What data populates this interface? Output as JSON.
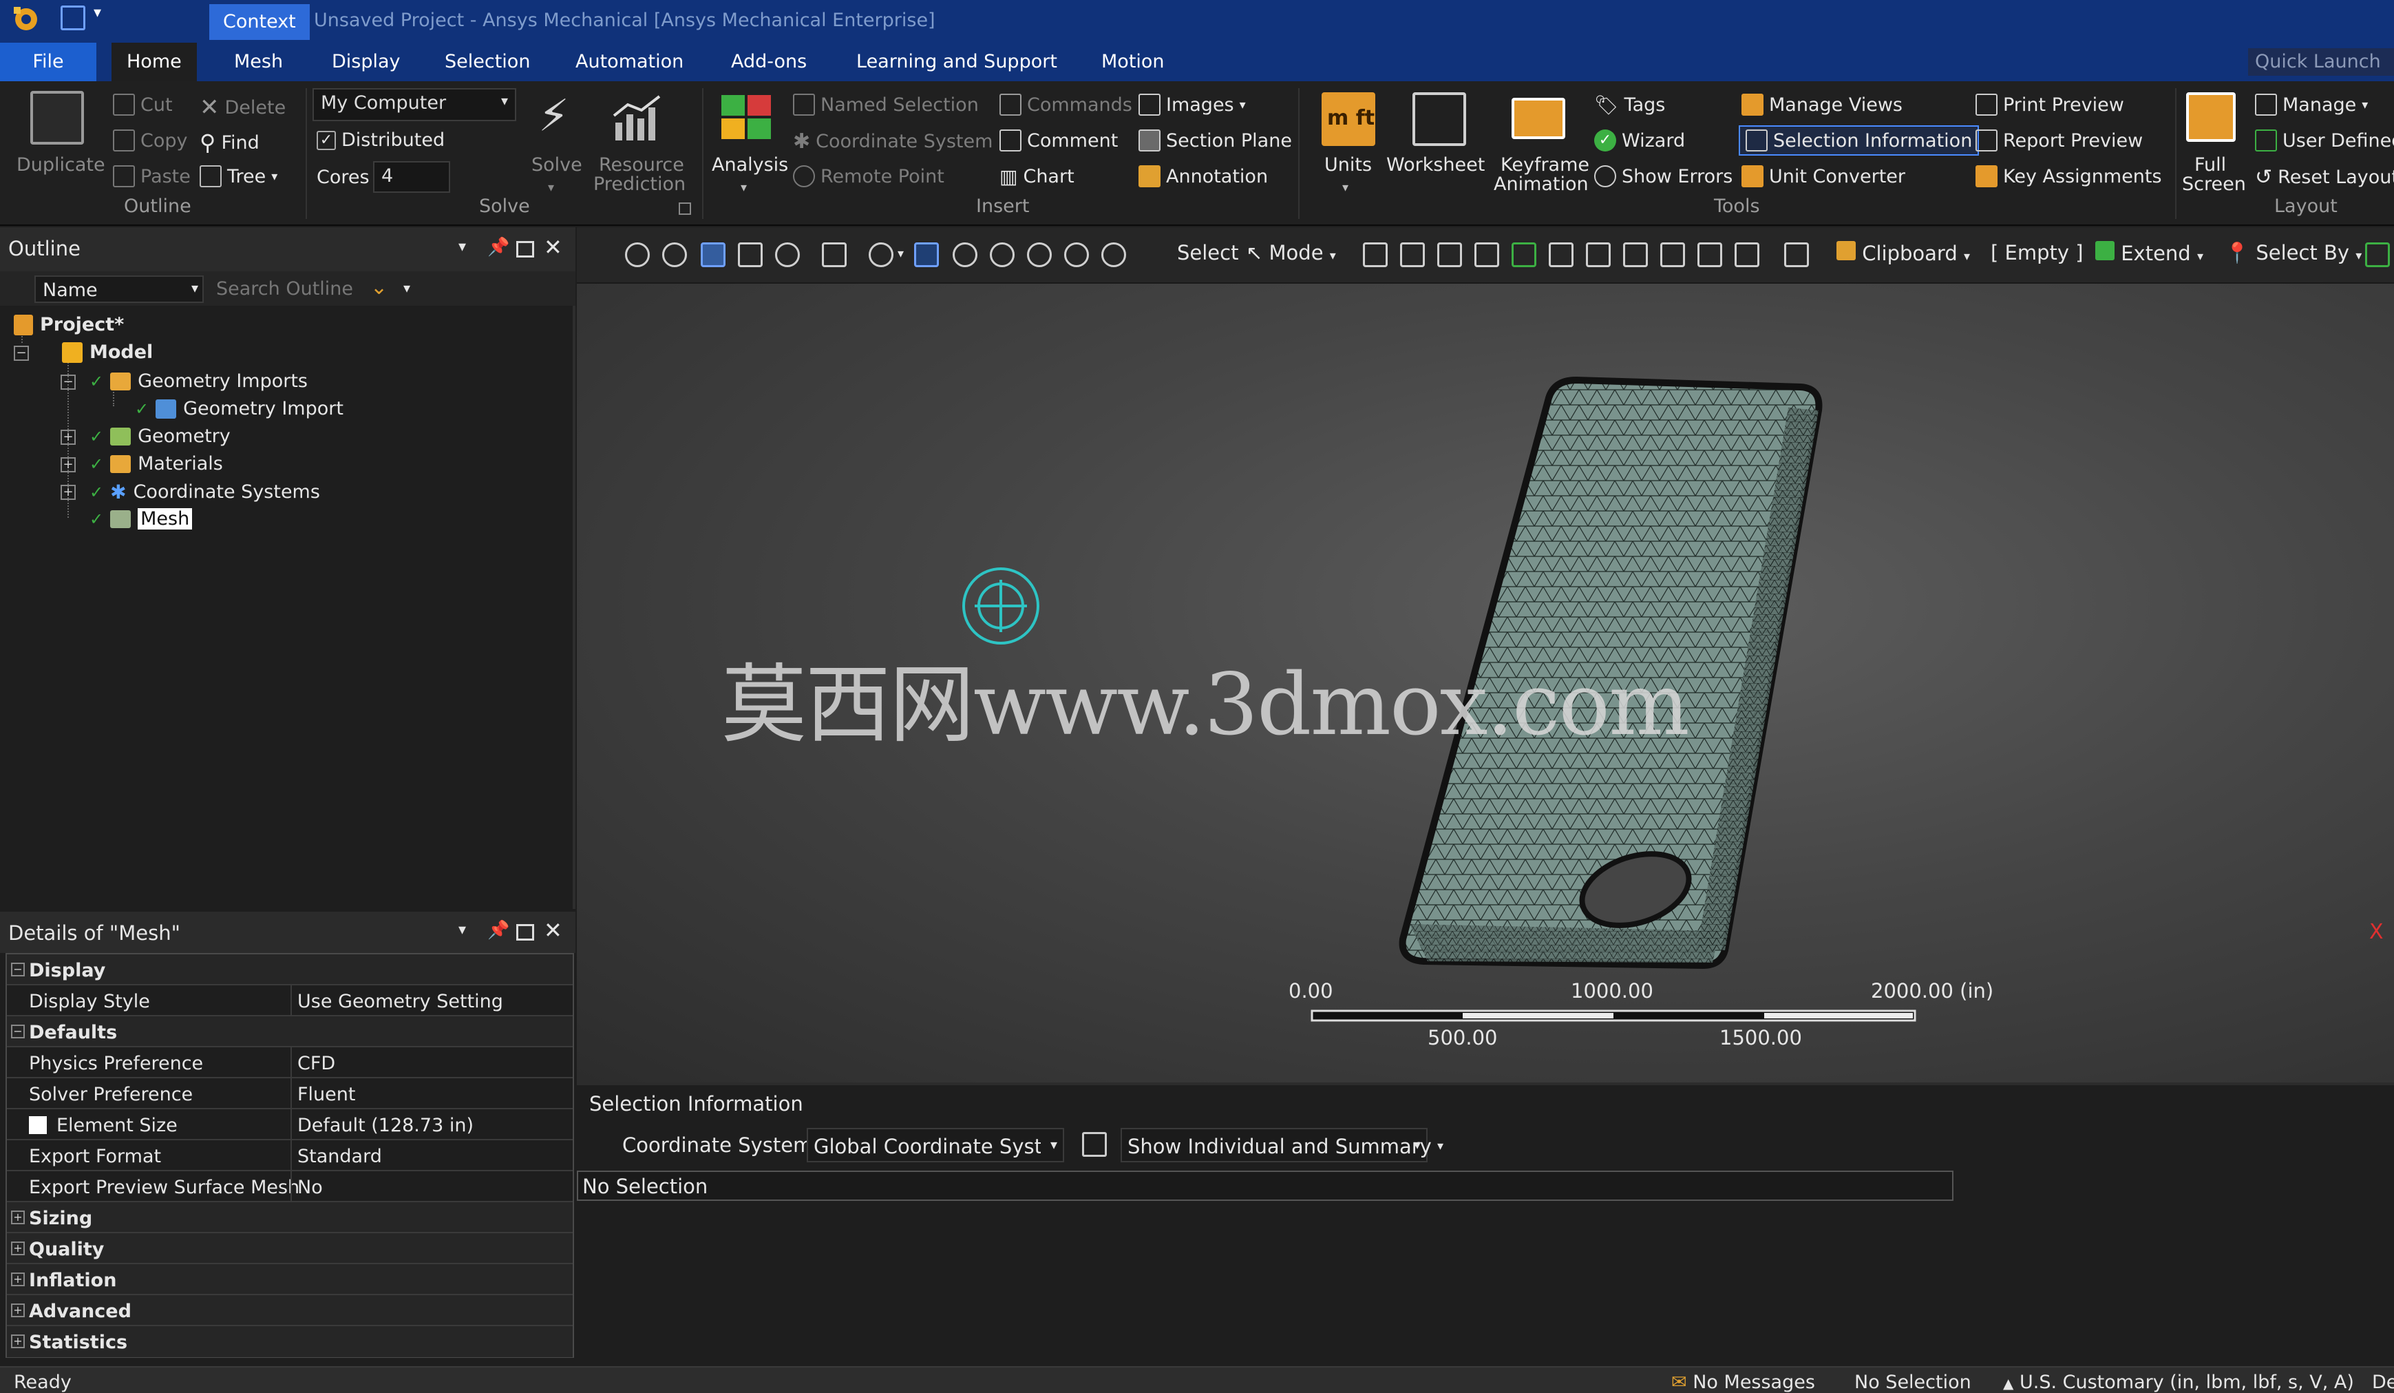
{
  "window": {
    "context_tab": "Context",
    "title": "Unsaved Project - Ansys Mechanical [Ansys Mechanical Enterprise]",
    "quick_launch_placeholder": "Quick Launch"
  },
  "tabs": [
    "File",
    "Home",
    "Mesh",
    "Display",
    "Selection",
    "Automation",
    "Add-ons",
    "Learning and Support",
    "Motion"
  ],
  "active_tab": "Home",
  "ribbon": {
    "outline_group": {
      "label": "Outline",
      "duplicate": "Duplicate",
      "cut": "Cut",
      "copy": "Copy",
      "paste": "Paste",
      "delete": "Delete",
      "find": "Find",
      "tree": "Tree"
    },
    "solve_group": {
      "label": "Solve",
      "computer": "My Computer",
      "distributed": "Distributed",
      "distributed_checked": true,
      "cores_label": "Cores",
      "cores_value": "4",
      "solve": "Solve",
      "resource_prediction_1": "Resource",
      "resource_prediction_2": "Prediction"
    },
    "insert_group": {
      "label": "Insert",
      "analysis": "Analysis",
      "named_selection": "Named Selection",
      "coordinate_system": "Coordinate System",
      "remote_point": "Remote Point",
      "commands": "Commands",
      "comment": "Comment",
      "chart": "Chart",
      "images": "Images",
      "section_plane": "Section Plane",
      "annotation": "Annotation"
    },
    "tools_group": {
      "label": "Tools",
      "units": "Units",
      "worksheet": "Worksheet",
      "keyframe_1": "Keyframe",
      "keyframe_2": "Animation",
      "tags": "Tags",
      "wizard": "Wizard",
      "show_errors": "Show Errors",
      "manage_views": "Manage Views",
      "selection_information": "Selection Information",
      "unit_converter": "Unit Converter",
      "print_preview": "Print Preview",
      "report_preview": "Report Preview",
      "key_assignments": "Key Assignments"
    },
    "layout_group": {
      "label": "Layout",
      "full_screen_1": "Full",
      "full_screen_2": "Screen",
      "manage": "Manage",
      "user_defined": "User Defined",
      "reset_layout": "Reset Layout"
    }
  },
  "outline": {
    "title": "Outline",
    "filter_field": "Name",
    "search_placeholder": "Search Outline",
    "tree": {
      "project": "Project*",
      "model": "Model",
      "geometry_imports": "Geometry Imports",
      "geometry_import": "Geometry Import",
      "geometry": "Geometry",
      "materials": "Materials",
      "coordinate_systems": "Coordinate Systems",
      "mesh": "Mesh"
    }
  },
  "details": {
    "title": "Details of \"Mesh\"",
    "rows": [
      {
        "type": "category",
        "label": "Display",
        "expanded": true
      },
      {
        "type": "prop",
        "key": "Display Style",
        "value": "Use Geometry Setting"
      },
      {
        "type": "category",
        "label": "Defaults",
        "expanded": true
      },
      {
        "type": "prop",
        "key": "Physics Preference",
        "value": "CFD"
      },
      {
        "type": "prop",
        "key": "Solver Preference",
        "value": "Fluent"
      },
      {
        "type": "prop",
        "key": "Element Size",
        "value": "Default (128.73 in)",
        "checkbox": true
      },
      {
        "type": "prop",
        "key": "Export Format",
        "value": "Standard"
      },
      {
        "type": "prop",
        "key": "Export Preview Surface Mesh",
        "value": "No"
      },
      {
        "type": "category",
        "label": "Sizing",
        "expanded": false
      },
      {
        "type": "category",
        "label": "Quality",
        "expanded": false
      },
      {
        "type": "category",
        "label": "Inflation",
        "expanded": false
      },
      {
        "type": "category",
        "label": "Advanced",
        "expanded": false
      },
      {
        "type": "category",
        "label": "Statistics",
        "expanded": false
      }
    ]
  },
  "graphics_toolbar": {
    "select": "Select",
    "mode": "Mode",
    "clipboard": "Clipboard",
    "empty": "[ Empty ]",
    "extend": "Extend",
    "select_by": "Select By"
  },
  "viewport": {
    "watermark": "莫西网www.3dmox.com",
    "scale_labels_top": [
      "0.00",
      "1000.00",
      "2000.00 (in)"
    ],
    "scale_labels_bottom": [
      "500.00",
      "1500.00"
    ],
    "axis_label": "X"
  },
  "selection_info": {
    "title": "Selection Information",
    "coord_label": "Coordinate System:",
    "coord_value": "Global Coordinate System",
    "show_mode": "Show Individual and Summary",
    "status": "No Selection"
  },
  "statusbar": {
    "ready": "Ready",
    "messages": "No Messages",
    "selection": "No Selection",
    "units": "U.S. Customary (in, lbm, lbf, s, V, A)",
    "extra": "De"
  },
  "colors": {
    "title_bar": "#10327a",
    "file_tab": "#1c5fcf",
    "mesh_fill": "#7a938d",
    "highlight": "#1c5fcf"
  }
}
